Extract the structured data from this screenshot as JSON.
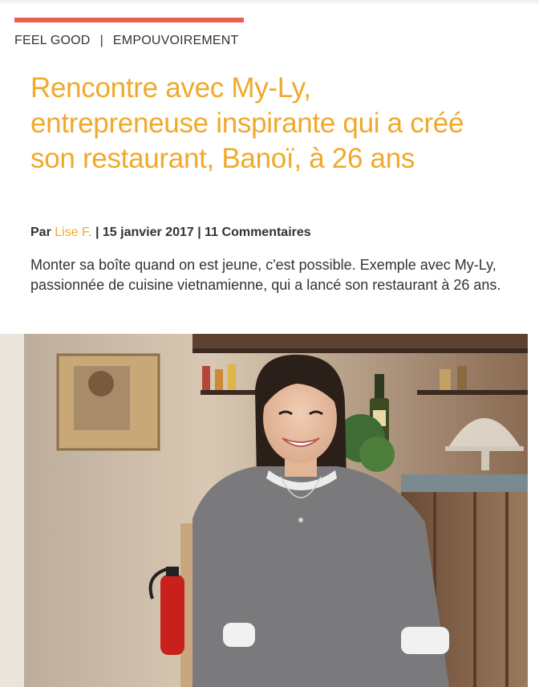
{
  "colors": {
    "accent_bar": "#ec5f4e",
    "title": "#f0a92b",
    "author_link": "#f0a92b",
    "text": "#333333"
  },
  "categories": {
    "primary": "FEEL GOOD",
    "separator": "|",
    "secondary": "EMPOUVOIREMENT"
  },
  "article": {
    "title": "Rencontre avec My-Ly, entrepreneuse inspirante qui a créé son restaurant, Banoï, à 26 ans",
    "byline_prefix": "Par",
    "author": "Lise F.",
    "date_sep": "|",
    "date": "15 janvier 2017",
    "comments_sep": "|",
    "comments": "11 Commentaires",
    "excerpt": "Monter sa boîte quand on est jeune, c'est possible. Exemple avec My-Ly, passionnée de cuisine vietnamienne, qui a lancé son restaurant à 26 ans."
  },
  "hero_image": {
    "subject": "smiling-woman-in-restaurant-photo"
  }
}
